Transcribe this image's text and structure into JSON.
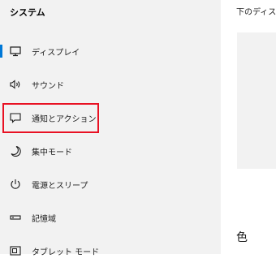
{
  "sidebar": {
    "section_title": "システム",
    "items": [
      {
        "label": "ディスプレイ",
        "icon": "monitor-icon",
        "selected": true
      },
      {
        "label": "サウンド",
        "icon": "speaker-icon"
      },
      {
        "label": "通知とアクション",
        "icon": "notification-icon",
        "highlighted": true
      },
      {
        "label": "集中モード",
        "icon": "moon-icon"
      },
      {
        "label": "電源とスリープ",
        "icon": "power-icon"
      },
      {
        "label": "記憶域",
        "icon": "storage-icon"
      },
      {
        "label": "タブレット モード",
        "icon": "tablet-icon"
      }
    ],
    "accent_color": "#0078d7",
    "highlight_color": "#e81123"
  },
  "main": {
    "top_text": "下のディス",
    "section_heading": "色"
  }
}
